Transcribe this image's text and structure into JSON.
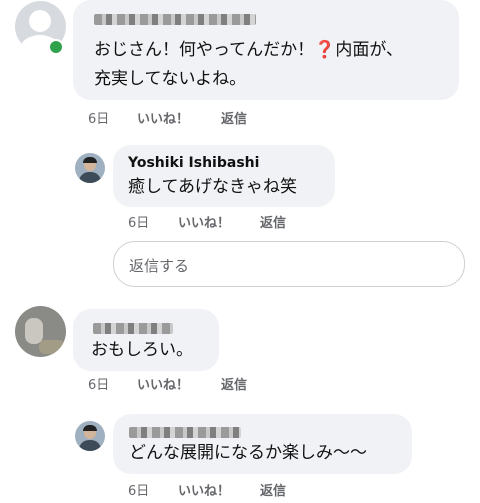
{
  "comments": [
    {
      "author": "",
      "author_blurred": true,
      "text_line1": "おじさん！何やってんだか！",
      "qmark": "❓",
      "text_line1_rest": "内面が、",
      "text_line2": "充実してないよね。",
      "time": "6日",
      "like": "いいね！",
      "reply": "返信",
      "online": true
    },
    {
      "author": "Yoshiki Ishibashi",
      "text": "癒してあげなきゃね笑",
      "time": "6日",
      "like": "いいね！",
      "reply": "返信"
    },
    {
      "author": "",
      "author_blurred": true,
      "text": "おもしろい。",
      "time": "6日",
      "like": "いいね！",
      "reply": "返信"
    },
    {
      "author": "",
      "author_blurred": true,
      "text": "どんな展開になるか楽しみ〜〜",
      "time": "6日",
      "like": "いいね！",
      "reply": "返信"
    }
  ],
  "reply_box": {
    "placeholder": "返信する"
  }
}
